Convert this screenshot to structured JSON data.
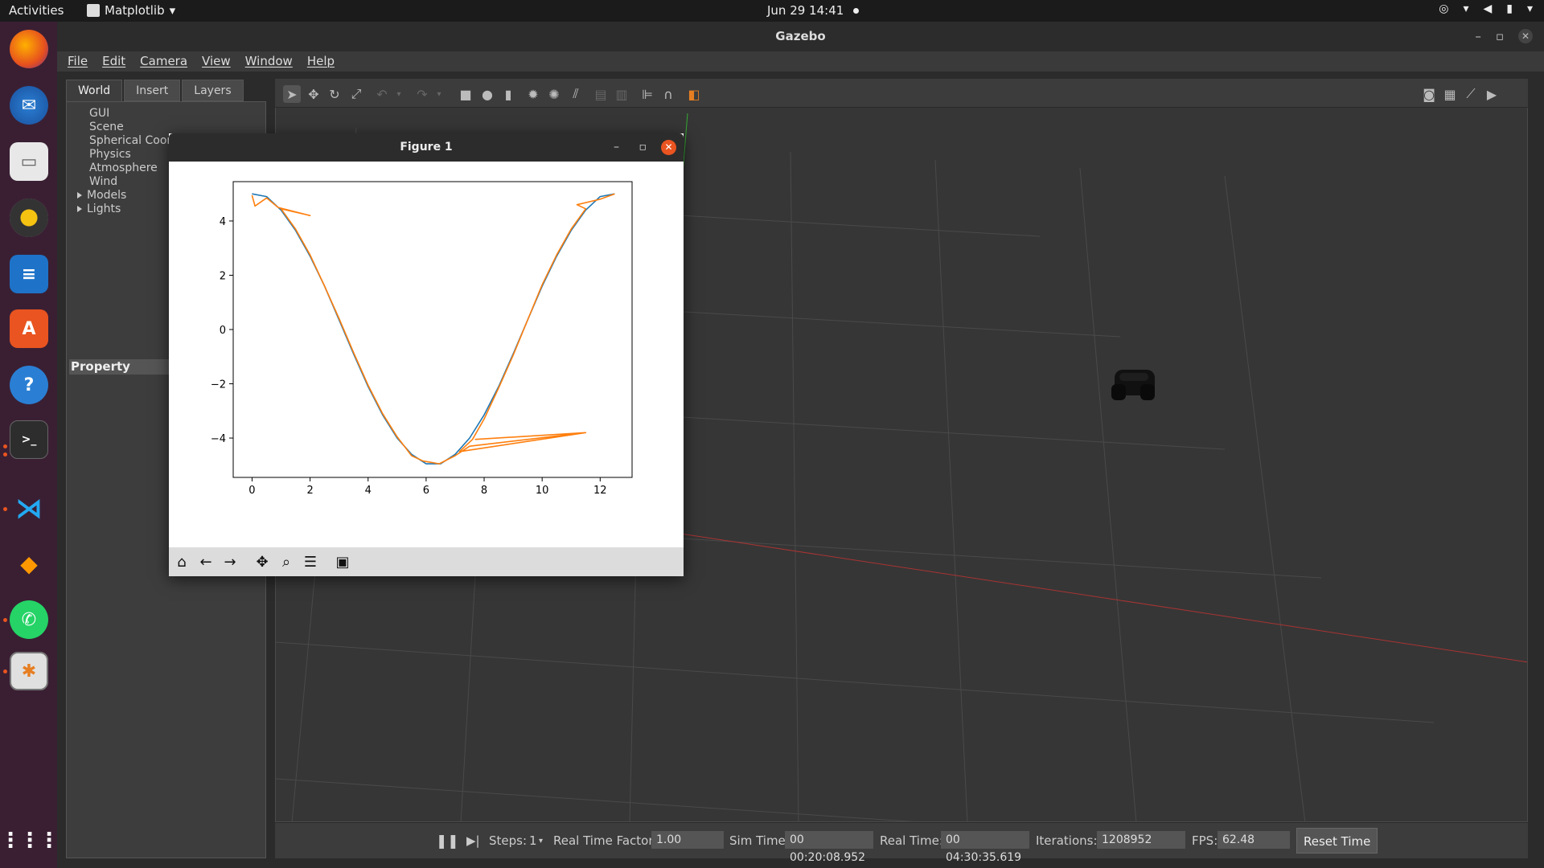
{
  "topbar": {
    "activities": "Activities",
    "app_menu": "Matplotlib",
    "clock": "Jun 29  14:41"
  },
  "dock": {
    "items": [
      "firefox-icon",
      "thunderbird-icon",
      "files-icon",
      "rhythmbox-icon",
      "writer-icon",
      "software-icon",
      "help-icon",
      "terminal-icon",
      "vscode-icon",
      "sublime-icon",
      "whatsapp-icon",
      "gazebo-icon"
    ],
    "show_apps": "show-applications-icon"
  },
  "gazebo": {
    "title": "Gazebo",
    "menu": [
      "File",
      "Edit",
      "Camera",
      "View",
      "Window",
      "Help"
    ],
    "tabs": [
      "World",
      "Insert",
      "Layers"
    ],
    "tree": [
      {
        "label": "GUI",
        "expandable": false
      },
      {
        "label": "Scene",
        "expandable": false
      },
      {
        "label": "Spherical Coor",
        "expandable": false
      },
      {
        "label": "Physics",
        "expandable": false
      },
      {
        "label": "Atmosphere",
        "expandable": false
      },
      {
        "label": "Wind",
        "expandable": false
      },
      {
        "label": "Models",
        "expandable": true
      },
      {
        "label": "Lights",
        "expandable": true
      }
    ],
    "property_label": "Property"
  },
  "status": {
    "steps_label": "Steps:",
    "steps_value": "1",
    "rtf_label": "Real Time Factor:",
    "rtf_value": "1.00",
    "sim_time_label": "Sim Time:",
    "sim_time_value": "00 00:20:08.952",
    "real_time_label": "Real Time:",
    "real_time_value": "00 04:30:35.619",
    "iterations_label": "Iterations:",
    "iterations_value": "1208952",
    "fps_label": "FPS:",
    "fps_value": "62.48",
    "reset_label": "Reset Time"
  },
  "figure": {
    "title": "Figure 1",
    "toolbar": [
      "home-icon",
      "back-icon",
      "forward-icon",
      "pan-icon",
      "zoom-icon",
      "configure-icon",
      "save-icon"
    ]
  },
  "chart_data": {
    "type": "line",
    "xlim": [
      -0.65,
      13.1
    ],
    "ylim": [
      -5.45,
      5.45
    ],
    "xticks": [
      0,
      2,
      4,
      6,
      8,
      10,
      12
    ],
    "yticks": [
      -4,
      -2,
      0,
      2,
      4
    ],
    "grid": false,
    "series": [
      {
        "color": "#1f77b4",
        "points": [
          [
            0,
            5.0
          ],
          [
            0.5,
            4.9
          ],
          [
            1,
            4.4
          ],
          [
            1.5,
            3.65
          ],
          [
            2,
            2.7
          ],
          [
            2.5,
            1.6
          ],
          [
            3,
            0.35
          ],
          [
            3.5,
            -0.9
          ],
          [
            4,
            -2.1
          ],
          [
            4.5,
            -3.15
          ],
          [
            5,
            -4.0
          ],
          [
            5.5,
            -4.6
          ],
          [
            6,
            -4.95
          ],
          [
            6.5,
            -4.95
          ],
          [
            7,
            -4.6
          ],
          [
            7.5,
            -4.0
          ],
          [
            8,
            -3.15
          ],
          [
            8.5,
            -2.1
          ],
          [
            9,
            -0.9
          ],
          [
            9.5,
            0.35
          ],
          [
            10,
            1.6
          ],
          [
            10.5,
            2.7
          ],
          [
            11,
            3.65
          ],
          [
            11.5,
            4.4
          ],
          [
            12,
            4.9
          ],
          [
            12.5,
            5.0
          ]
        ]
      },
      {
        "color": "#ff7f0e",
        "points": [
          [
            0,
            4.95
          ],
          [
            0.1,
            4.55
          ],
          [
            0.5,
            4.85
          ],
          [
            0.9,
            4.5
          ],
          [
            2,
            4.2
          ],
          [
            1,
            4.45
          ],
          [
            1.5,
            3.7
          ],
          [
            2,
            2.75
          ],
          [
            2.5,
            1.6
          ],
          [
            3,
            0.4
          ],
          [
            3.5,
            -0.85
          ],
          [
            4,
            -2.05
          ],
          [
            4.5,
            -3.1
          ],
          [
            5,
            -3.95
          ],
          [
            5.5,
            -4.65
          ],
          [
            5.9,
            -4.85
          ],
          [
            6.2,
            -4.9
          ],
          [
            6.45,
            -4.95
          ],
          [
            7,
            -4.65
          ],
          [
            7.5,
            -4.3
          ],
          [
            11.5,
            -3.8
          ],
          [
            7.7,
            -4.05
          ],
          [
            11.5,
            -3.8
          ],
          [
            7.15,
            -4.5
          ],
          [
            7.6,
            -4.05
          ],
          [
            8,
            -3.3
          ],
          [
            8.5,
            -2.15
          ],
          [
            9,
            -0.95
          ],
          [
            9.5,
            0.35
          ],
          [
            10,
            1.65
          ],
          [
            10.5,
            2.75
          ],
          [
            11,
            3.7
          ],
          [
            11.5,
            4.45
          ],
          [
            11.2,
            4.6
          ],
          [
            12,
            4.8
          ],
          [
            12.5,
            5.0
          ]
        ]
      }
    ]
  }
}
